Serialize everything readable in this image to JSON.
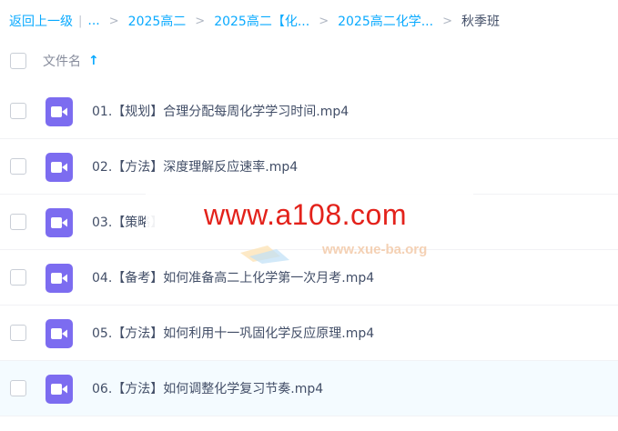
{
  "breadcrumb": {
    "back": "返回上一级",
    "ellipsis": "...",
    "items": [
      "2025高二",
      "2025高二【化...",
      "2025高二化学..."
    ],
    "current": "秋季班"
  },
  "header": {
    "column_name": "文件名",
    "sort_icon": "arrow-up-icon"
  },
  "files": [
    {
      "name": "01.【规划】合理分配每周化学学习时间.mp4",
      "icon": "video-icon"
    },
    {
      "name": "02.【方法】深度理解反应速率.mp4",
      "icon": "video-icon"
    },
    {
      "name": "03.【策略】",
      "icon": "video-icon"
    },
    {
      "name": "04.【备考】如何准备高二上化学第一次月考.mp4",
      "icon": "video-icon"
    },
    {
      "name": "05.【方法】如何利用十一巩固化学反应原理.mp4",
      "icon": "video-icon"
    },
    {
      "name": "06.【方法】如何调整化学复习节奏.mp4",
      "icon": "video-icon"
    }
  ],
  "watermark": {
    "main": "www.a108.com",
    "sub": "www.xue-ba.org"
  },
  "colors": {
    "accent": "#09aaff",
    "video_icon": "#7c6cf0",
    "watermark": "#e3221b",
    "row_hover": "#f4fbff"
  }
}
